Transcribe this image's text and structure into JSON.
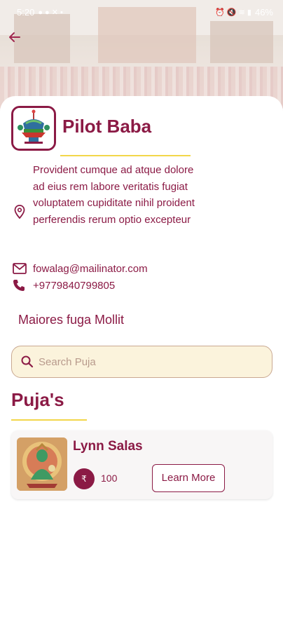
{
  "status_bar": {
    "time": "5:20",
    "battery": "46%"
  },
  "header": {
    "title": "Pilot Baba"
  },
  "contact": {
    "address": "Provident cumque ad atque dolore ad eius rem labore veritatis fugiat voluptatem cupiditate nihil proident perferendis rerum optio excepteur",
    "email": "fowalag@mailinator.com",
    "phone": "+9779840799805"
  },
  "subtitle": "Maiores fuga Mollit",
  "search": {
    "placeholder": "Search Puja"
  },
  "section": {
    "title": "Puja's"
  },
  "pujas": [
    {
      "name": "Lynn Salas",
      "price": "100",
      "currency_symbol": "₹",
      "action_label": "Learn More"
    }
  ],
  "colors": {
    "primary": "#8b1a45",
    "accent": "#f2d64a",
    "search_bg": "#fbf3dc"
  },
  "icons": {
    "back": "arrow-left-icon",
    "location": "location-pin-icon",
    "email": "envelope-icon",
    "phone": "phone-icon",
    "search": "search-icon",
    "currency": "currency-icon"
  }
}
